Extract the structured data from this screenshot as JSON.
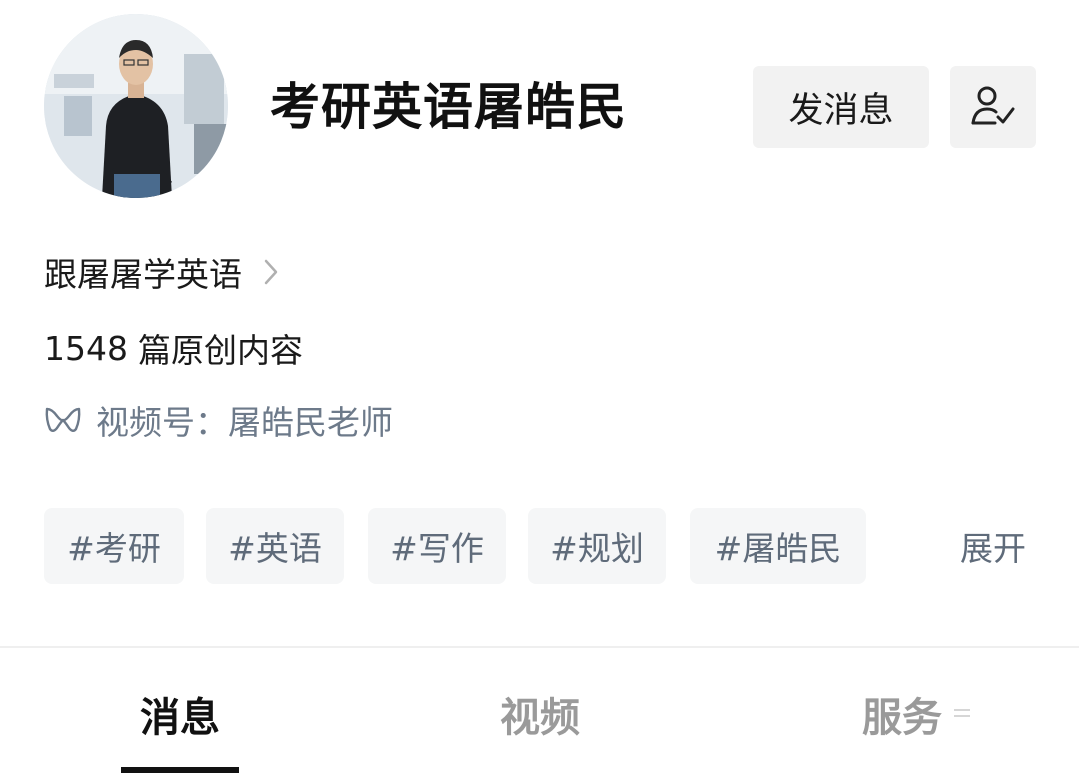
{
  "header": {
    "name": "考研英语屠皓民",
    "message_button": "发消息",
    "follow_icon": "user-check-icon"
  },
  "profile": {
    "bio": "跟屠屠学英语",
    "article_count": "1548",
    "article_suffix": "篇原创内容",
    "channel_label": "视频号：",
    "channel_name": "屠皓民老师"
  },
  "tags": [
    "#考研",
    "#英语",
    "#写作",
    "#规划",
    "#屠皓民"
  ],
  "expand_label": "展开",
  "tabs": [
    {
      "label": "消息",
      "active": true
    },
    {
      "label": "视频",
      "active": false
    },
    {
      "label": "服务",
      "active": false
    }
  ],
  "colors": {
    "accent_text": "#111111",
    "muted_text": "#6d7a8a",
    "tag_bg": "#f5f6f7",
    "button_bg": "#f2f2f2",
    "inactive_tab": "#9a9a9a"
  }
}
